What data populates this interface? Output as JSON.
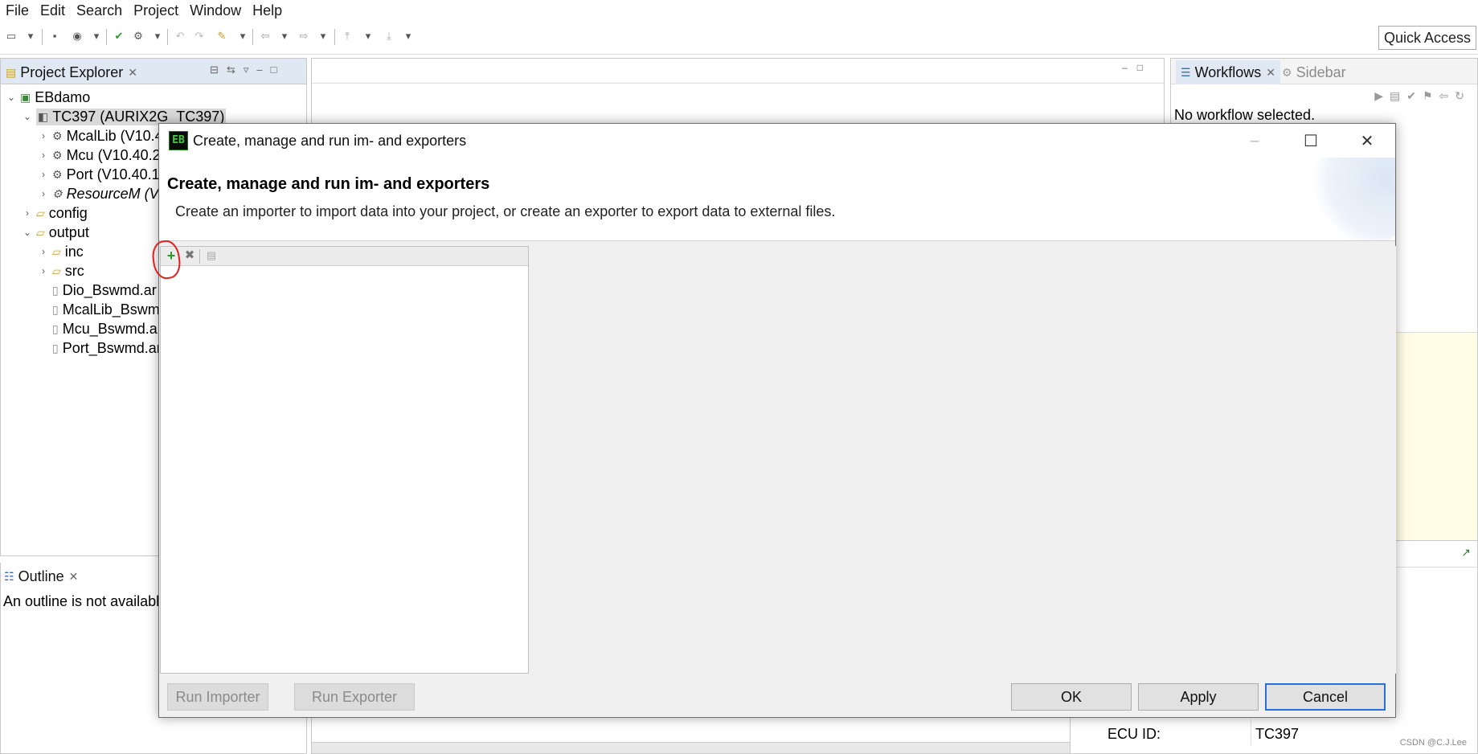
{
  "menu": [
    "File",
    "Edit",
    "Search",
    "Project",
    "Window",
    "Help"
  ],
  "toolbar": {
    "quick_access": "Quick Access"
  },
  "project_explorer": {
    "tab_label": "Project Explorer",
    "tree": [
      {
        "label": "EBdamo"
      },
      {
        "label": "TC397 (AURIX2G_TC397)"
      },
      {
        "label": "McalLib (V10.4"
      },
      {
        "label": "Mcu (V10.40.2"
      },
      {
        "label": "Port (V10.40.1,"
      },
      {
        "label": "ResourceM (V1"
      },
      {
        "label": "config"
      },
      {
        "label": "output"
      },
      {
        "label": "inc"
      },
      {
        "label": "src"
      },
      {
        "label": "Dio_Bswmd.ar"
      },
      {
        "label": "McalLib_Bswm"
      },
      {
        "label": "Mcu_Bswmd.ar"
      },
      {
        "label": "Port_Bswmd.ar"
      }
    ]
  },
  "outline": {
    "tab_label": "Outline",
    "message": "An outline is not availabl"
  },
  "workflows": {
    "tab_label": "Workflows",
    "sidebar_label": "Sidebar",
    "message": "No workflow selected."
  },
  "properties": {
    "ecu_label": "ECU ID:",
    "ecu_value": "TC397"
  },
  "dialog": {
    "title": "Create, manage and run im- and exporters",
    "header_title": "Create, manage and run im- and exporters",
    "header_desc": "Create an importer to import data into your project, or create an exporter to export data to external files.",
    "run_importer": "Run Importer",
    "run_exporter": "Run Exporter",
    "ok": "OK",
    "apply": "Apply",
    "cancel": "Cancel"
  },
  "watermark": "CSDN @C.J.Lee"
}
